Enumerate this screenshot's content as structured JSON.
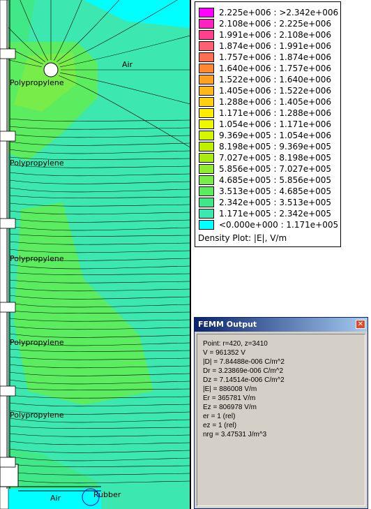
{
  "plot": {
    "region_labels": [
      "Air",
      "Polypropylene",
      "Polypropylene",
      "Polypropylene",
      "Polypropylene",
      "Polypropylene",
      "Air",
      "Rubber"
    ]
  },
  "legend": {
    "rows": [
      {
        "range": "2.225e+006 : >2.342e+006",
        "color": "#ff00ff"
      },
      {
        "range": "2.108e+006 : 2.225e+006",
        "color": "#ff20c0"
      },
      {
        "range": "1.991e+006 : 2.108e+006",
        "color": "#ff4090"
      },
      {
        "range": "1.874e+006 : 1.991e+006",
        "color": "#ff6070"
      },
      {
        "range": "1.757e+006 : 1.874e+006",
        "color": "#ff7050"
      },
      {
        "range": "1.640e+006 : 1.757e+006",
        "color": "#ff8830"
      },
      {
        "range": "1.522e+006 : 1.640e+006",
        "color": "#ffa020"
      },
      {
        "range": "1.405e+006 : 1.522e+006",
        "color": "#ffb818"
      },
      {
        "range": "1.288e+006 : 1.405e+006",
        "color": "#ffd010"
      },
      {
        "range": "1.171e+006 : 1.288e+006",
        "color": "#ffec00"
      },
      {
        "range": "1.054e+006 : 1.171e+006",
        "color": "#ecf800"
      },
      {
        "range": "9.369e+005 : 1.054e+006",
        "color": "#d4f400"
      },
      {
        "range": "8.198e+005 : 9.369e+005",
        "color": "#bef000"
      },
      {
        "range": "7.027e+005 : 8.198e+005",
        "color": "#a8ec10"
      },
      {
        "range": "5.856e+005 : 7.027e+005",
        "color": "#90ec30"
      },
      {
        "range": "4.685e+005 : 5.856e+005",
        "color": "#78ec48"
      },
      {
        "range": "3.513e+005 : 4.685e+005",
        "color": "#5cec60"
      },
      {
        "range": "2.342e+005 : 3.513e+005",
        "color": "#40e888"
      },
      {
        "range": "1.171e+005 : 2.342e+005",
        "color": "#3de8b0"
      },
      {
        "range": "<0.000e+000 : 1.171e+005",
        "color": "#00ffff"
      }
    ],
    "caption": "Density Plot: |E|, V/m"
  },
  "output": {
    "title": "FEMM Output",
    "close_glyph": "✕",
    "lines": [
      "Point: r=420, z=3410",
      "V   = 961352 V",
      "|D| = 7.84488e-006 C/m^2",
      "Dr  = 3.23869e-006 C/m^2",
      "Dz  = 7.14514e-006 C/m^2",
      "|E| = 886008 V/m",
      "Er  = 365781 V/m",
      "Ez  = 806978 V/m",
      "er  = 1 (rel)",
      "ez  = 1 (rel)",
      "nrg = 3.47531 J/m^3"
    ]
  }
}
